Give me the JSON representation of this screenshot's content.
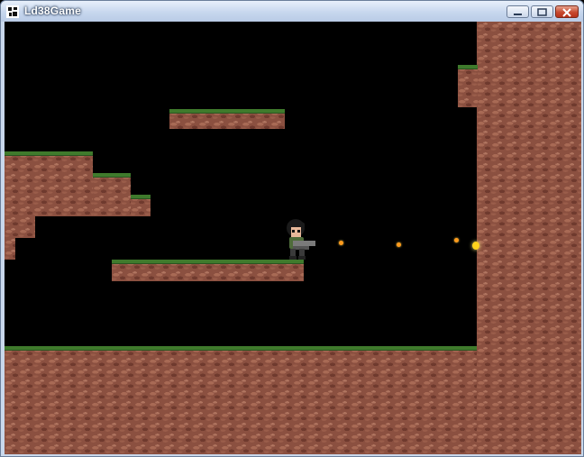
{
  "window": {
    "title": "Ld38Game",
    "buttons": [
      "minimize",
      "maximize",
      "close"
    ]
  },
  "game": {
    "player": "character-with-gun",
    "projectiles": 3,
    "colors": {
      "dirt": "#8b5040",
      "grass": "#3f7a2c",
      "sky": "#000000",
      "bullet": "#ff9a1c"
    }
  }
}
